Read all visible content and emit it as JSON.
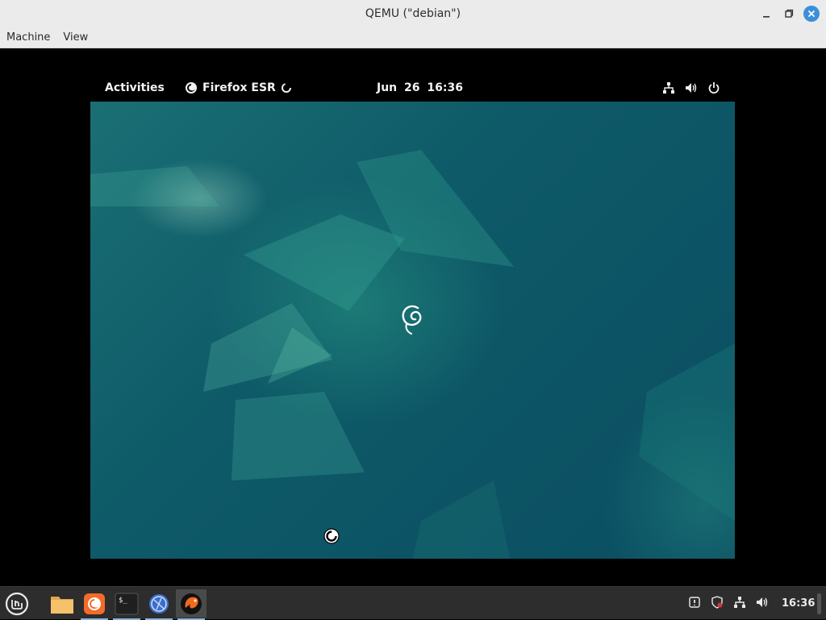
{
  "host_window": {
    "title": "QEMU (\"debian\")",
    "menu": [
      "Machine",
      "View"
    ],
    "controls": {
      "minimize_icon": "minimize-icon",
      "maximize_icon": "maximize-icon",
      "close_icon": "close-icon",
      "close_color": "#3c8fd9"
    }
  },
  "guest": {
    "topbar": {
      "activities_label": "Activities",
      "app_name": "Firefox ESR",
      "clock": "Jun 26  16:36",
      "tray_icons": [
        "network-wired-icon",
        "volume-icon",
        "power-icon"
      ]
    },
    "desktop": {
      "logo_icon": "debian-swirl-icon",
      "cursor_icon": "busy-cursor-icon",
      "accent_colors": [
        "#0e5a68",
        "#1a6f74",
        "#2a9a86"
      ]
    }
  },
  "host_taskbar": {
    "launchers": [
      {
        "name": "mint-menu-icon"
      },
      {
        "name": "folder-icon"
      },
      {
        "name": "firefox-icon"
      },
      {
        "name": "terminal-icon"
      },
      {
        "name": "web-app-icon"
      },
      {
        "name": "qemu-icon"
      }
    ],
    "tray_icons": [
      "update-manager-icon",
      "shield-icon",
      "network-icon",
      "volume-icon"
    ],
    "clock": "16:36"
  }
}
